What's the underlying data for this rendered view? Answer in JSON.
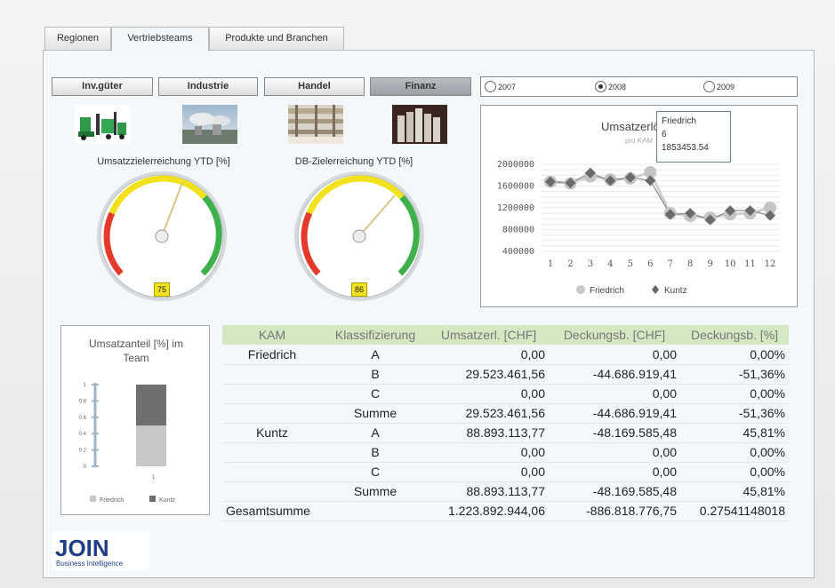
{
  "tabs": [
    "Regionen",
    "Vertriebsteams",
    "Produkte und Branchen"
  ],
  "active_tab": 1,
  "segments": [
    "Inv.güter",
    "Industrie",
    "Handel",
    "Finanz"
  ],
  "active_segment": 3,
  "gauges": [
    {
      "title": "Umsatzzielerreichung YTD [%]",
      "value": "75"
    },
    {
      "title": "DB-Zielerreichung YTD [%]",
      "value": "86"
    }
  ],
  "years": [
    "2007",
    "2008",
    "2009"
  ],
  "selected_year": 1,
  "line_chart": {
    "title": "Umsatzerlöse Ist",
    "subtitle": "pro KAM",
    "tooltip": {
      "name": "Friedrich",
      "x": "6",
      "value": "1853453.54"
    },
    "legend": [
      "Friedrich",
      "Kuntz"
    ]
  },
  "chart_data": [
    {
      "type": "line",
      "title": "Umsatzerlöse Ist",
      "subtitle": "pro KAM",
      "x": [
        1,
        2,
        3,
        4,
        5,
        6,
        7,
        8,
        9,
        10,
        11,
        12
      ],
      "x_ticks": [
        "1",
        "2",
        "3",
        "4",
        "5",
        "6",
        "7",
        "8",
        "9",
        "10",
        "11",
        "12"
      ],
      "y_ticks": [
        "400000",
        "800000",
        "1200000",
        "1600000",
        "2000000"
      ],
      "ylim": [
        400000,
        2000000
      ],
      "series": [
        {
          "name": "Friedrich",
          "values": [
            1680000,
            1650000,
            1780000,
            1720000,
            1740000,
            1853453.54,
            1100000,
            1050000,
            1020000,
            1080000,
            1100000,
            1200000
          ]
        },
        {
          "name": "Kuntz",
          "values": [
            1680000,
            1660000,
            1840000,
            1700000,
            1760000,
            1700000,
            1080000,
            1100000,
            980000,
            1150000,
            1150000,
            1060000
          ]
        }
      ],
      "legend_position": "bottom"
    },
    {
      "type": "bar",
      "title": "Umsatzanteil [%] im Team",
      "categories": [
        "1"
      ],
      "series": [
        {
          "name": "Friedrich",
          "values": [
            0.5
          ]
        },
        {
          "name": "Kuntz",
          "values": [
            0.5
          ]
        }
      ],
      "y_ticks": [
        "0",
        "0.2",
        "0.4",
        "0.6",
        "0.8",
        "1"
      ],
      "ylim": [
        0,
        1
      ],
      "stacked": true,
      "legend_position": "bottom"
    }
  ],
  "share_chart": {
    "title_line1": "Umsatzanteil [%] im",
    "title_line2": "Team",
    "legend": [
      "Friedrich",
      "Kuntz"
    ],
    "x_tick": "1"
  },
  "table": {
    "headers": [
      "KAM",
      "Klassifizierung",
      "Umsatzerl. [CHF]",
      "Deckungsb. [CHF]",
      "Deckungsb. [%]"
    ],
    "rows": [
      [
        "Friedrich",
        "A",
        "0,00",
        "0,00",
        "0,00%"
      ],
      [
        "",
        "B",
        "29.523.461,56",
        "-44.686.919,41",
        "-51,36%"
      ],
      [
        "",
        "C",
        "0,00",
        "0,00",
        "0,00%"
      ],
      [
        "",
        "Summe",
        "29.523.461,56",
        "-44.686.919,41",
        "-51,36%"
      ],
      [
        "Kuntz",
        "A",
        "88.893.113,77",
        "-48.169.585,48",
        "45,81%"
      ],
      [
        "",
        "B",
        "0,00",
        "0,00",
        "0,00%"
      ],
      [
        "",
        "C",
        "0,00",
        "0,00",
        "0,00%"
      ],
      [
        "",
        "Summe",
        "88.893.113,77",
        "-48.169.585,48",
        "45,81%"
      ]
    ],
    "total": [
      "Gesamtsumme",
      "1.223.892.944,06",
      "-886.818.776,75",
      "0.27541148018"
    ]
  },
  "logo": {
    "word": "JOIN",
    "tagline": "Business Intelligence"
  },
  "colors": {
    "header_green": "#d4e8c2",
    "friedrich": "#c8c8c8",
    "kuntz": "#6f6f6f"
  }
}
